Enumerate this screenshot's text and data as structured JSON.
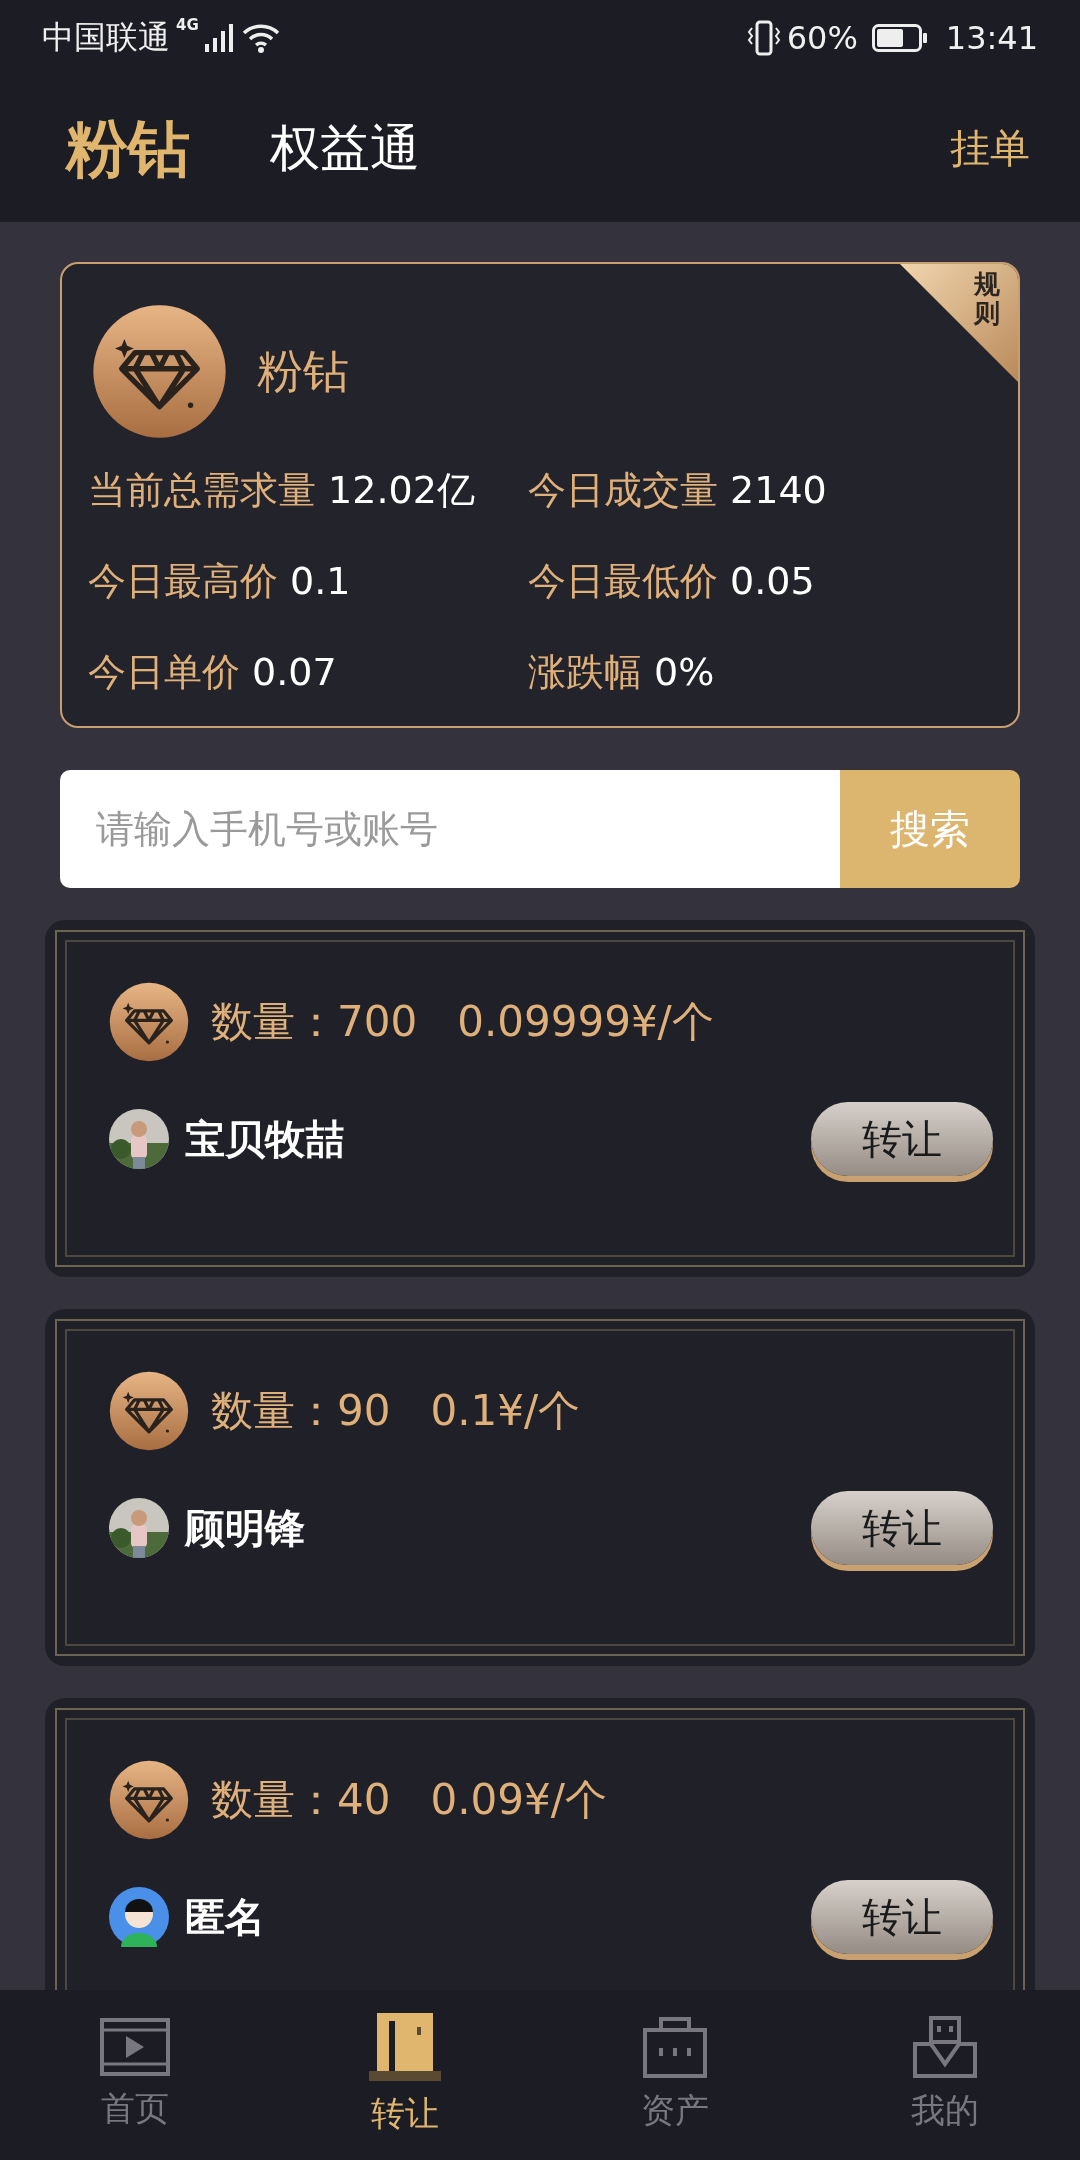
{
  "status_bar": {
    "carrier": "中国联通",
    "network": "4G",
    "battery": "60%",
    "time": "13:41"
  },
  "header": {
    "tabs": [
      {
        "label": "粉钻",
        "selected": true
      },
      {
        "label": "权益通",
        "selected": false
      }
    ],
    "action": "挂单"
  },
  "summary": {
    "name": "粉钻",
    "corner": "规则",
    "stats": [
      {
        "label": "当前总需求量",
        "value": "12.02亿"
      },
      {
        "label": "今日成交量",
        "value": "2140"
      },
      {
        "label": "今日最高价",
        "value": "0.1"
      },
      {
        "label": "今日最低价",
        "value": "0.05"
      },
      {
        "label": "今日单价",
        "value": "0.07"
      },
      {
        "label": "涨跌幅",
        "value": "0%"
      }
    ]
  },
  "search": {
    "placeholder": "请输入手机号或账号",
    "button": "搜索"
  },
  "listings": [
    {
      "quantity_label": "数量：",
      "quantity": "700",
      "price": "0.09999¥/个",
      "user": "宝贝牧喆",
      "button": "转让"
    },
    {
      "quantity_label": "数量：",
      "quantity": "90",
      "price": "0.1¥/个",
      "user": "顾明锋",
      "button": "转让"
    },
    {
      "quantity_label": "数量：",
      "quantity": "40",
      "price": "0.09¥/个",
      "user": "匿名",
      "kind": "cartoon",
      "button": "转让"
    }
  ],
  "nav": [
    {
      "label": "首页",
      "kind": "home",
      "selected": false
    },
    {
      "label": "转让",
      "kind": "transfer",
      "selected": true
    },
    {
      "label": "资产",
      "kind": "assets",
      "selected": false
    },
    {
      "label": "我的",
      "kind": "profile",
      "selected": false
    }
  ]
}
